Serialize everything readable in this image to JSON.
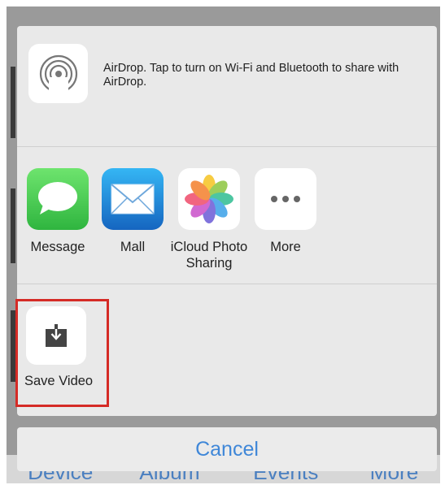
{
  "airdrop": {
    "icon": "airdrop-icon",
    "description": "AirDrop. Tap to turn on Wi-Fi and Bluetooth to share with AirDrop."
  },
  "apps": [
    {
      "label": "Message",
      "icon": "messages-icon",
      "color": "#4cd964"
    },
    {
      "label": "Mall",
      "icon": "mail-icon",
      "color": "#1e88e5"
    },
    {
      "label": "iCloud Photo Sharing",
      "icon": "photos-icon",
      "color": "#ffffff"
    },
    {
      "label": "More",
      "icon": "more-icon",
      "color": "#ffffff"
    }
  ],
  "actions": [
    {
      "label": "Save Video",
      "icon": "save-download-icon"
    }
  ],
  "cancel_label": "Cancel",
  "bottom_tabs": [
    "Device",
    "Album",
    "Events",
    "More"
  ],
  "colors": {
    "sheet_bg": "#e9e9e9",
    "cancel_text": "#3f87d8",
    "highlight": "#d52b26"
  }
}
